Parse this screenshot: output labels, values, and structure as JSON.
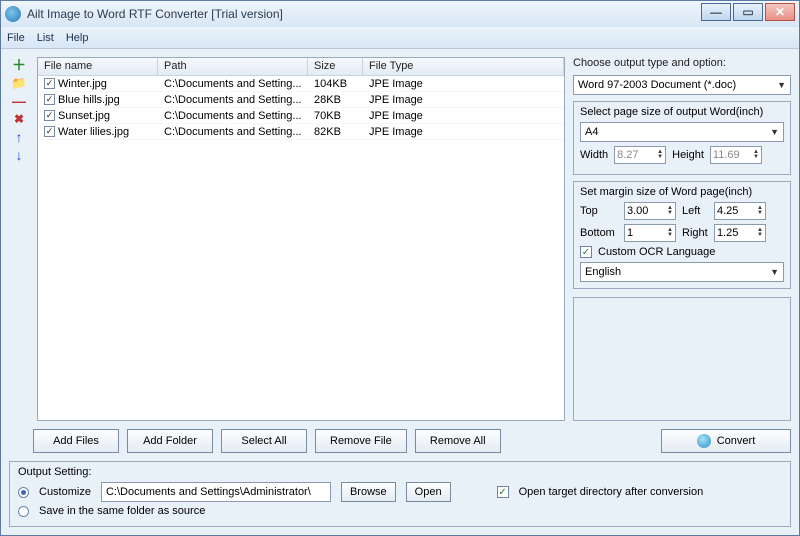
{
  "window": {
    "title": "Ailt Image to Word RTF Converter [Trial version]"
  },
  "menubar": {
    "items": [
      "File",
      "List",
      "Help"
    ]
  },
  "columns": {
    "filename": "File name",
    "path": "Path",
    "size": "Size",
    "filetype": "File Type"
  },
  "files": [
    {
      "name": "Winter.jpg",
      "path": "C:\\Documents and Setting...",
      "size": "104KB",
      "type": "JPE Image",
      "checked": true
    },
    {
      "name": "Blue hills.jpg",
      "path": "C:\\Documents and Setting...",
      "size": "28KB",
      "type": "JPE Image",
      "checked": true
    },
    {
      "name": "Sunset.jpg",
      "path": "C:\\Documents and Setting...",
      "size": "70KB",
      "type": "JPE Image",
      "checked": true
    },
    {
      "name": "Water lilies.jpg",
      "path": "C:\\Documents and Setting...",
      "size": "82KB",
      "type": "JPE Image",
      "checked": true
    }
  ],
  "buttons": {
    "add_files": "Add Files",
    "add_folder": "Add Folder",
    "select_all": "Select All",
    "remove_file": "Remove File",
    "remove_all": "Remove All",
    "convert": "Convert",
    "browse": "Browse",
    "open": "Open"
  },
  "output_type": {
    "label": "Choose output type and option:",
    "selected": "Word 97-2003 Document (*.doc)"
  },
  "page_size": {
    "group_label": "Select page size of output Word(inch)",
    "preset": "A4",
    "width_label": "Width",
    "width": "8.27",
    "height_label": "Height",
    "height": "11.69"
  },
  "margins": {
    "group_label": "Set margin size of Word page(inch)",
    "top_label": "Top",
    "top": "3.00",
    "left_label": "Left",
    "left": "4.25",
    "bottom_label": "Bottom",
    "bottom": "1",
    "right_label": "Right",
    "right": "1.25"
  },
  "ocr": {
    "label": "Custom OCR Language",
    "checked": true,
    "language": "English"
  },
  "output_setting": {
    "group_label": "Output Setting:",
    "customize_label": "Customize",
    "customize_selected": true,
    "path": "C:\\Documents and Settings\\Administrator\\",
    "save_same_label": "Save in the same folder as source",
    "open_after_label": "Open target directory after conversion",
    "open_after_checked": true
  }
}
